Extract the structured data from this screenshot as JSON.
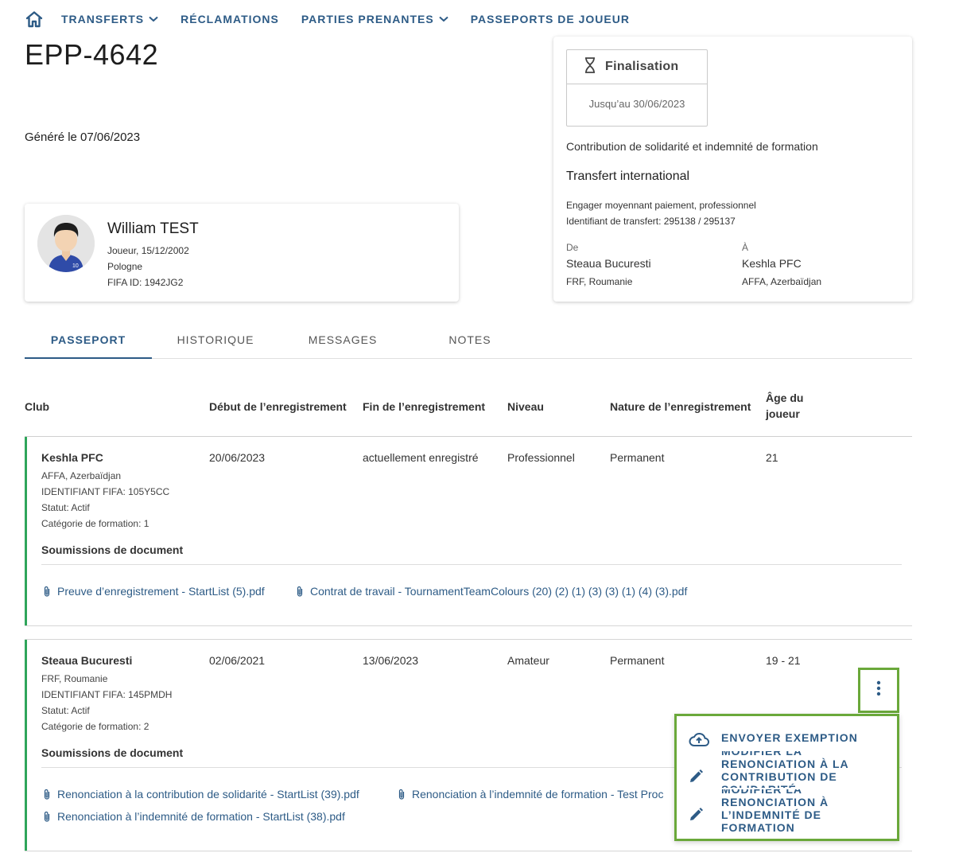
{
  "nav": {
    "items": [
      {
        "label": "TRANSFERTS",
        "dropdown": true
      },
      {
        "label": "RÉCLAMATIONS",
        "dropdown": false
      },
      {
        "label": "PARTIES PRENANTES",
        "dropdown": true
      },
      {
        "label": "PASSEPORTS DE JOUEUR",
        "dropdown": false
      }
    ]
  },
  "page": {
    "title": "EPP-4642",
    "generated": "Généré le 07/06/2023"
  },
  "player": {
    "name": "William TEST",
    "role_dob": "Joueur, 15/12/2002",
    "country": "Pologne",
    "fifa_id": "FIFA ID: 1942JG2",
    "jersey_number": "10"
  },
  "transfer": {
    "status_label": "Finalisation",
    "status_until": "Jusqu’au 30/06/2023",
    "claim_type": "Contribution de solidarité et indemnité de formation",
    "transfer_type": "Transfert international",
    "engagement": "Engager moyennant paiement, professionnel",
    "transfer_id": "Identifiant de transfert: 295138 / 295137",
    "from_label": "De",
    "from_club": "Steaua Bucuresti",
    "from_assoc": "FRF, Roumanie",
    "to_label": "À",
    "to_club": "Keshla PFC",
    "to_assoc": "AFFA, Azerbaïdjan"
  },
  "tabs": [
    {
      "label": "PASSEPORT",
      "active": true
    },
    {
      "label": "HISTORIQUE",
      "active": false
    },
    {
      "label": "MESSAGES",
      "active": false
    },
    {
      "label": "NOTES",
      "active": false
    }
  ],
  "table": {
    "headers": {
      "club": "Club",
      "start": "Début de l’enregistrement",
      "end": "Fin de l’enregistrement",
      "level": "Niveau",
      "nature": "Nature de l’enregistrement",
      "age_line1": "Âge du",
      "age_line2": "joueur"
    },
    "rows": [
      {
        "club": "Keshla PFC",
        "assoc": "AFFA, Azerbaïdjan",
        "fifa_id": "IDENTIFIANT FIFA: 105Y5CC",
        "status": "Statut: Actif",
        "category": "Catégorie de formation: 1",
        "start": "20/06/2023",
        "end": "actuellement enregistré",
        "level": "Professionnel",
        "nature": "Permanent",
        "age": "21",
        "docs_title": "Soumissions de document",
        "docs": [
          "Preuve d’enregistrement - StartList (5).pdf",
          "Contrat de travail - TournamentTeamColours (20) (2) (1) (3) (3) (1) (4) (3).pdf"
        ]
      },
      {
        "club": "Steaua Bucuresti",
        "assoc": "FRF, Roumanie",
        "fifa_id": "IDENTIFIANT FIFA: 145PMDH",
        "status": "Statut: Actif",
        "category": "Catégorie de formation: 2",
        "start": "02/06/2021",
        "end": "13/06/2023",
        "level": "Amateur",
        "nature": "Permanent",
        "age": "19 - 21",
        "docs_title": "Soumissions de document",
        "docs": [
          "Renonciation à la contribution de solidarité - StartList (39).pdf",
          "Renonciation à l’indemnité de formation - Test Proc",
          "Renonciation à l’indemnité de formation - StartList (38).pdf"
        ]
      }
    ]
  },
  "menu": {
    "items": [
      {
        "label": "ENVOYER EXEMPTION",
        "icon": "cloud-upload-icon"
      },
      {
        "label": "MODIFIER LA RENONCIATION À LA CONTRIBUTION DE SOLIDARITÉ",
        "icon": "pencil-icon"
      },
      {
        "label": "MODIFIER LA RENONCIATION À L’INDEMNITÉ DE FORMATION",
        "icon": "pencil-icon"
      }
    ]
  },
  "colors": {
    "primary": "#2d5b86",
    "row_accent": "#2fa55a",
    "highlight": "#6aa83a"
  }
}
